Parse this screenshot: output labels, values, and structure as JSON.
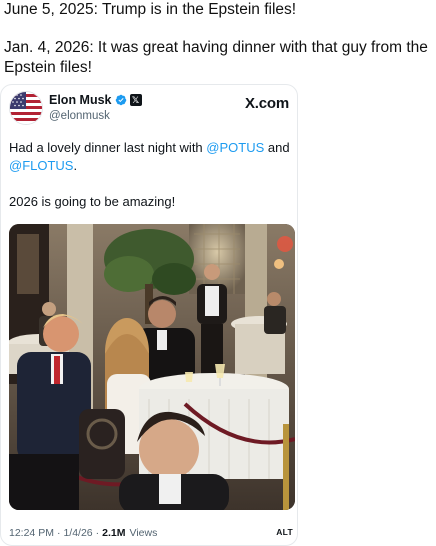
{
  "post": {
    "line1": "June 5, 2025: Trump is in the Epstein files!",
    "line2": "Jan. 4, 2026: It was great having dinner with that guy from the Epstein files!"
  },
  "tweet": {
    "author_name": "Elon Musk",
    "handle": "@elonmusk",
    "brand": "X.com",
    "text_before": "Had a lovely dinner last night with ",
    "mention1": "@POTUS",
    "text_mid": " and",
    "mention2": "@FLOTUS",
    "text_after": ".",
    "paragraph2": "2026 is going to be amazing!",
    "time": "12:24 PM",
    "date": "1/4/26",
    "views_count": "2.1M",
    "views_label": "Views",
    "alt_label": "ALT",
    "separator": "·"
  },
  "icons": {
    "avatar": "us-flag-avatar",
    "verified": "verified-check-icon",
    "affiliate": "x-logo-badge-icon"
  },
  "colors": {
    "mention": "#1d9bf0",
    "verified": "#1d9bf0",
    "muted": "#536471"
  }
}
